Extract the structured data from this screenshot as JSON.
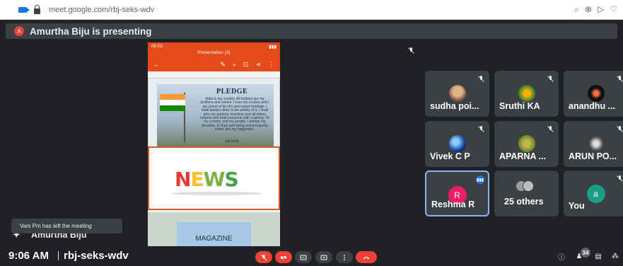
{
  "browser": {
    "url": "meet.google.com/rbj-seks-wdv"
  },
  "presenting": {
    "avatar_letter": "A",
    "text": "Amurtha Biju is presenting"
  },
  "presentation": {
    "status_time": "09:02",
    "app_title": "Presentation (3)",
    "slide1_title": "PLEDGE",
    "slide1_text": "India is my country. All Indians are my brothers and sisters. I love my country and I am proud of its rich and varied heritage. I shall always strive to be worthy of it. I shall give my parents, teachers and all elders respect and treat everyone with courtesy. To my country and my people, I pledge my devotion. In their well being and prosperity alone, lies my happiness.",
    "slide1_footer": "Jai hind.",
    "slide2_word": [
      "N",
      "E",
      "W",
      "S"
    ],
    "slide3_title": "MAGAZINE"
  },
  "participants": [
    {
      "name": "sudha poi...",
      "muted": true
    },
    {
      "name": "Sruthi KA",
      "muted": true
    },
    {
      "name": "anandhu ...",
      "muted": true
    },
    {
      "name": "Vivek C P",
      "muted": true
    },
    {
      "name": "APARNA ...",
      "muted": true
    },
    {
      "name": "ARUN PO...",
      "muted": true
    },
    {
      "name": "Reshma R",
      "letter": "R",
      "speaking": true
    },
    {
      "name": "25 others"
    },
    {
      "name": "You",
      "letter": "a",
      "muted": true
    }
  ],
  "toast": {
    "text": "Vani Pm has left the meeting",
    "presenter_label": "Amurtha Biju"
  },
  "bottom": {
    "time": "9:06 AM",
    "meeting_code": "rbj-seks-wdv",
    "participant_count": "34"
  },
  "colors": {
    "app_bg": "#202124",
    "tile_bg": "#3c4043",
    "danger": "#ea4335",
    "accent": "#1a73e8",
    "slides_toolbar": "#e64a19"
  },
  "icons": {
    "camera": "video-camera-icon",
    "lock": "lock-icon",
    "mic_off": "mic-off-icon",
    "video_off": "video-off-icon",
    "captions": "captions-icon",
    "present": "present-screen-icon",
    "more": "more-vert-icon",
    "end_call": "end-call-icon",
    "info": "info-icon",
    "people": "people-icon",
    "chat": "chat-icon",
    "activities": "activities-icon"
  }
}
